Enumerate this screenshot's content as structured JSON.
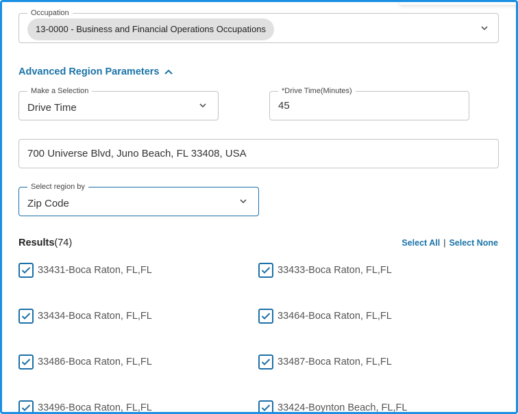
{
  "occupation": {
    "legend": "Occupation",
    "chip": "13-0000 - Business and Financial Operations Occupations"
  },
  "advanced": {
    "toggle_label": "Advanced Region Parameters"
  },
  "selection": {
    "legend": "Make a Selection",
    "value": "Drive Time"
  },
  "drive_time": {
    "legend": "*Drive Time(Minutes)",
    "value": "45"
  },
  "address": {
    "value": "700 Universe Blvd, Juno Beach, FL 33408, USA"
  },
  "region_by": {
    "legend": "Select region by",
    "value": "Zip Code"
  },
  "results": {
    "title": "Results",
    "count": "(74)",
    "select_all": "Select All",
    "separator": "|",
    "select_none": "Select None",
    "items": [
      "33431-Boca Raton, FL,FL",
      "33433-Boca Raton, FL,FL",
      "33434-Boca Raton, FL,FL",
      "33464-Boca Raton, FL,FL",
      "33486-Boca Raton, FL,FL",
      "33487-Boca Raton, FL,FL",
      "33496-Boca Raton, FL,FL",
      "33424-Boynton Beach, FL,FL"
    ]
  },
  "colors": {
    "accent": "#1a73a8",
    "frame": "#1a8fe3",
    "chip_bg": "#e0e0e0"
  }
}
